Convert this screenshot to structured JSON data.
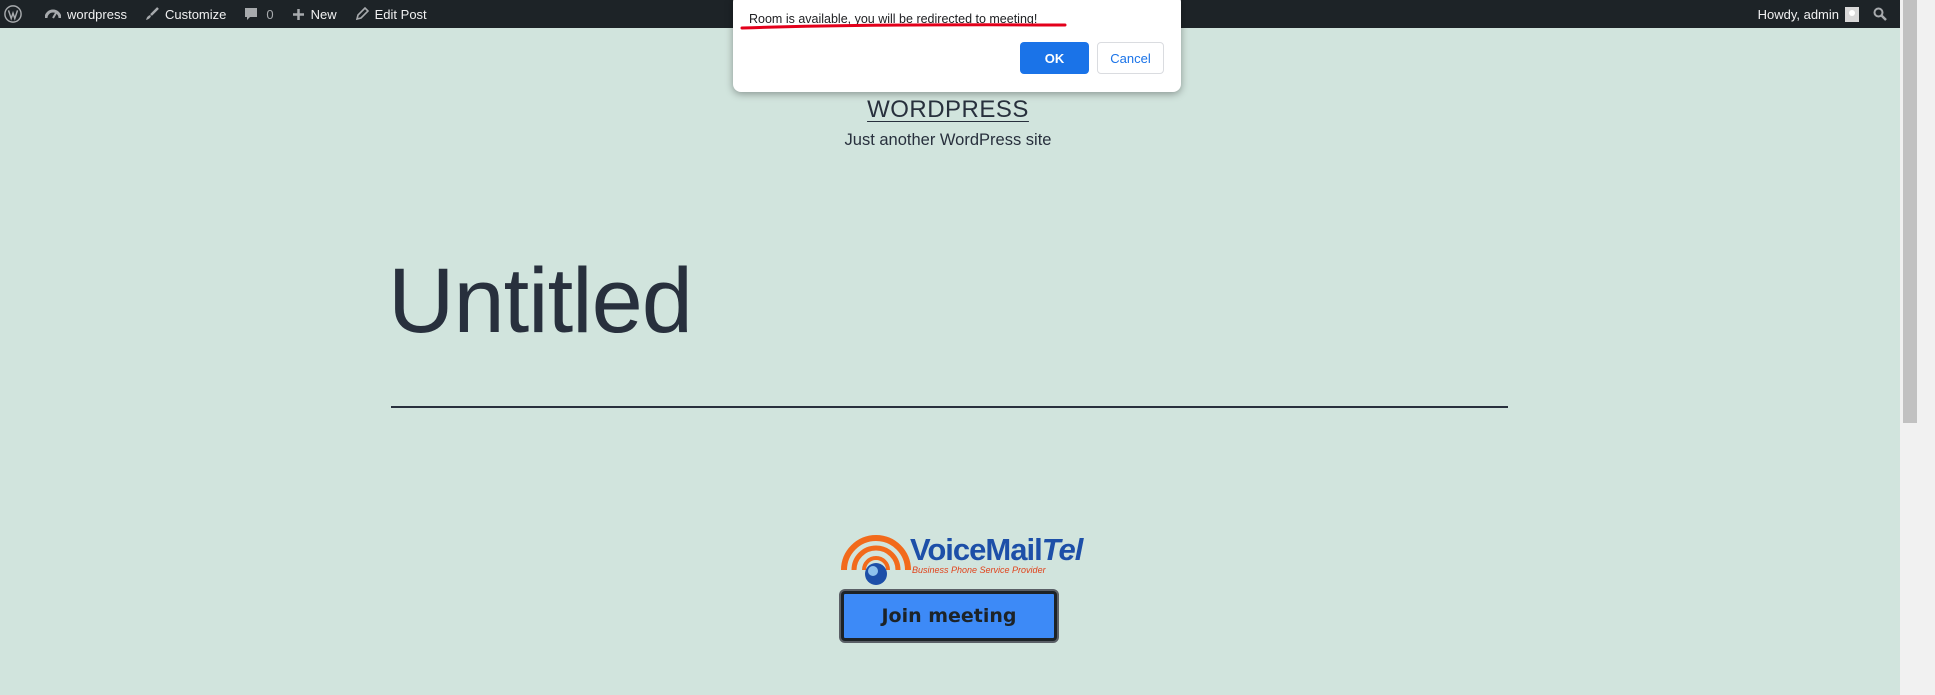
{
  "admin_bar": {
    "site_name": "wordpress",
    "customize": "Customize",
    "comments_count": "0",
    "new": "New",
    "edit_post": "Edit Post",
    "howdy": "Howdy, admin"
  },
  "dialog": {
    "message": "Room is available, you will be redirected to meeting!",
    "ok": "OK",
    "cancel": "Cancel"
  },
  "site": {
    "title": "WORDPRESS",
    "description": "Just another WordPress site"
  },
  "post": {
    "title": "Untitled"
  },
  "logo": {
    "name_main": "VoiceMail",
    "name_tail": "Tel",
    "tagline": "Business Phone Service Provider"
  },
  "join_button": "Join meeting",
  "colors": {
    "background": "#d1e4dd",
    "admin_bar": "#1d2327",
    "join_button": "#3d8af7",
    "ok_button": "#1a73e8",
    "annotation": "#e3001b"
  }
}
